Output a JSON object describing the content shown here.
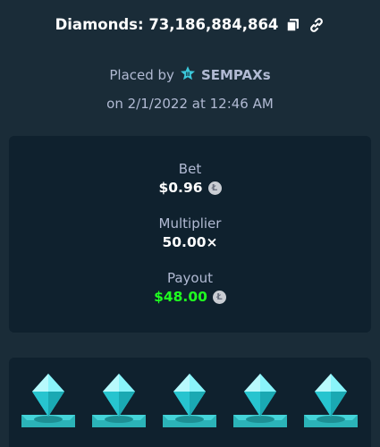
{
  "header": {
    "title": "Diamonds: 73,186,884,864",
    "copy_icon": "copy-icon",
    "link_icon": "link-icon"
  },
  "placed": {
    "prefix": "Placed by",
    "user_icon": "star-badge-icon",
    "username": "SEMPAXs",
    "date": "on 2/1/2022 at 12:46 AM"
  },
  "stats": {
    "bet_label": "Bet",
    "bet_value": "$0.96",
    "multiplier_label": "Multiplier",
    "multiplier_value": "50.00×",
    "payout_label": "Payout",
    "payout_value": "$48.00",
    "currency_icon": "litecoin-icon",
    "payout_color": "#1fff20"
  },
  "board": {
    "gems": [
      "diamond-icon",
      "diamond-icon",
      "diamond-icon",
      "diamond-icon",
      "diamond-icon"
    ]
  },
  "colors": {
    "background": "#1a2c38",
    "card": "#0f212e",
    "muted_text": "#b1bad3",
    "gem": "#4ee5f0"
  }
}
